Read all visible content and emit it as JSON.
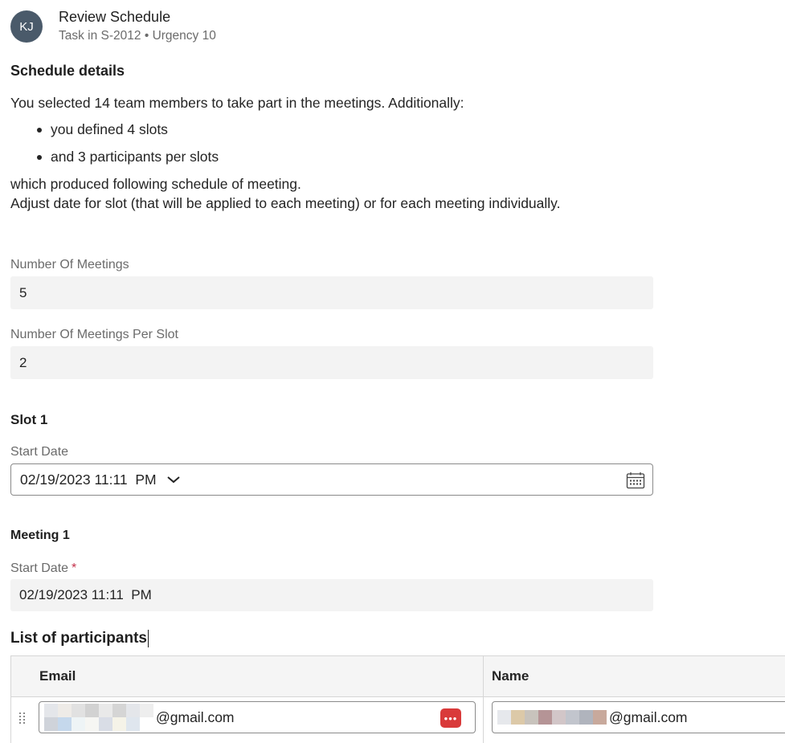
{
  "header": {
    "avatar_initials": "KJ",
    "title": "Review Schedule",
    "subtitle": "Task in S-2012 • Urgency 10"
  },
  "details": {
    "heading": "Schedule details",
    "intro": "You selected 14 team members to take part in the meetings. Additionally:",
    "bullets": [
      "you defined 4 slots",
      "and 3 participants per slots"
    ],
    "line1": "which produced following schedule of meeting.",
    "line2": "Adjust date for slot (that will be applied to each meeting) or for each meeting individually."
  },
  "fields": {
    "meetings_label": "Number Of Meetings",
    "meetings_value": "5",
    "per_slot_label": "Number Of Meetings Per Slot",
    "per_slot_value": "2"
  },
  "slot": {
    "heading": "Slot 1",
    "start_label": "Start Date",
    "start_value": "02/19/2023 11:11  PM"
  },
  "meeting": {
    "heading": "Meeting 1",
    "start_label": "Start Date",
    "required_mark": "*",
    "start_value": "02/19/2023 11:11  PM"
  },
  "participants": {
    "heading": "List of participants",
    "columns": [
      "Email",
      "Name"
    ],
    "rows": [
      {
        "email_suffix": "@gmail.com",
        "name_suffix": "@gmail.com"
      }
    ]
  },
  "colors": {
    "avatar_bg": "#4a5a6a",
    "field_bg": "#f3f3f3",
    "required": "#c4314b",
    "password_icon": "#d93a3a"
  },
  "icons": [
    "calendar-icon",
    "chevron-down-icon",
    "drag-handle-icon",
    "password-manager-icon"
  ]
}
